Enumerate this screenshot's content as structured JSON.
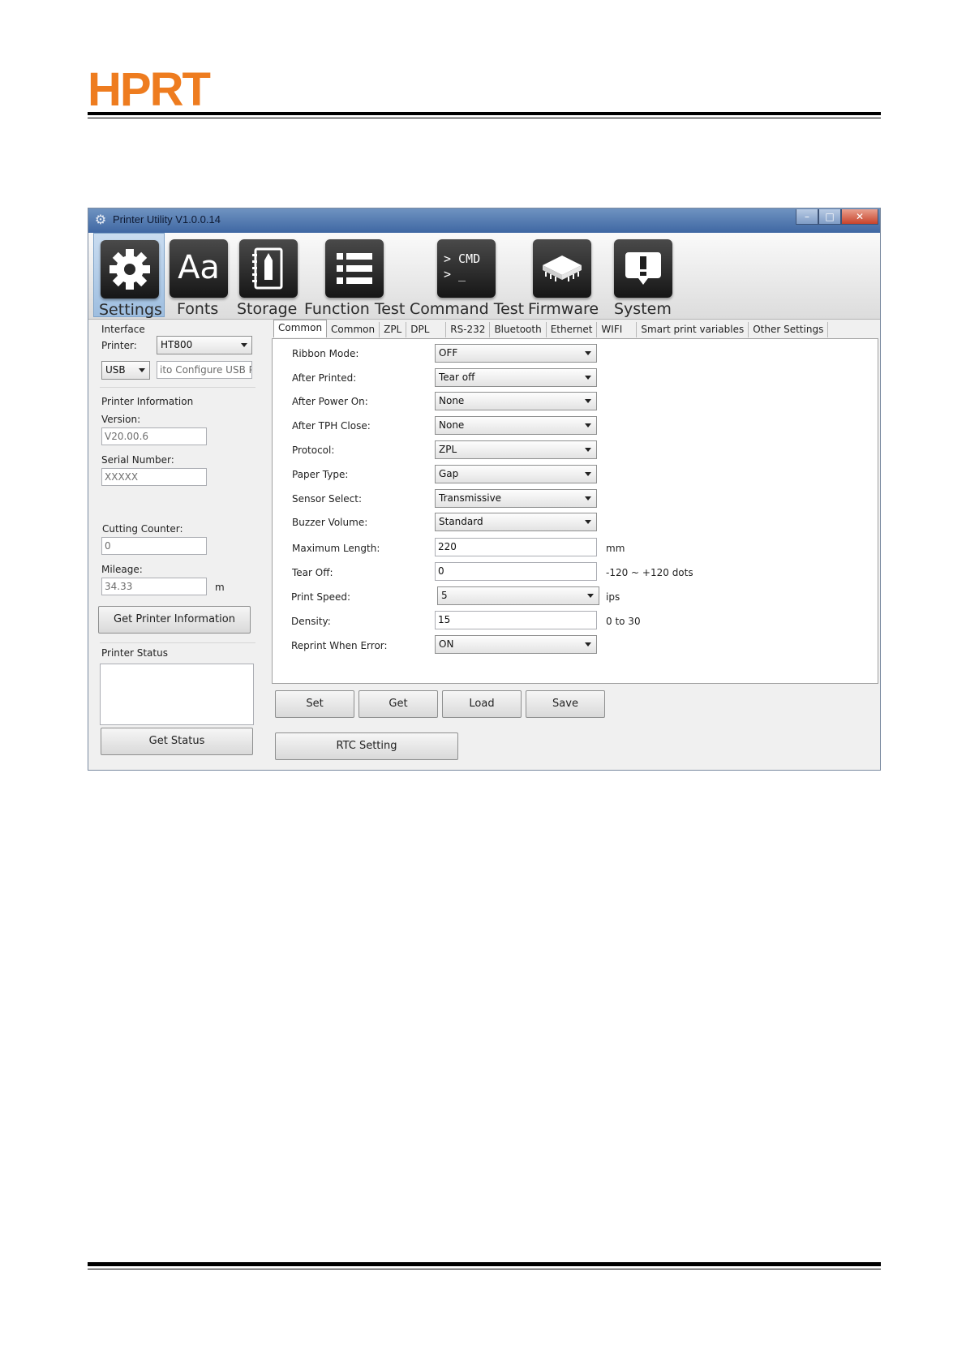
{
  "doc": {
    "brand": "HPRT"
  },
  "window": {
    "title": "Printer Utility  V1.0.0.14",
    "buttons": {
      "minimize": "–",
      "maximize": "□",
      "close": "✕"
    }
  },
  "toolbar": {
    "items": [
      {
        "label": "Settings",
        "icon": "gear-icon"
      },
      {
        "label": "Fonts",
        "icon": "font-icon",
        "glyph": "Aa"
      },
      {
        "label": "Storage",
        "icon": "storage-icon"
      },
      {
        "label": "Function Test",
        "icon": "list-icon"
      },
      {
        "label": "Command Test",
        "icon": "terminal-icon",
        "glyph1": "> CMD",
        "glyph2": "> _"
      },
      {
        "label": "Firmware",
        "icon": "chip-icon"
      },
      {
        "label": "System",
        "icon": "alert-icon"
      }
    ]
  },
  "left": {
    "interface_label": "Interface",
    "printer_label": "Printer:",
    "printer_value": "HT800",
    "port_value": "USB",
    "port_config_placeholder": "ito Configure USB Pc",
    "info_label": "Printer Information",
    "version_label": "Version:",
    "version_value": "V20.00.6",
    "serial_label": "Serial Number:",
    "serial_value": "XXXXX",
    "cutting_label": "Cutting Counter:",
    "cutting_value": "0",
    "mileage_label": "Mileage:",
    "mileage_value": "34.33",
    "mileage_unit": "m",
    "get_info_button": "Get Printer Information",
    "status_label": "Printer Status",
    "get_status_button": "Get Status"
  },
  "tabs": [
    "Common",
    "Common",
    "ZPL",
    "DPL",
    "RS-232",
    "Bluetooth",
    "Ethernet",
    "WIFI",
    "Smart print variables",
    "Other Settings"
  ],
  "settings": {
    "ribbon_mode": {
      "label": "Ribbon Mode:",
      "value": "OFF"
    },
    "after_printed": {
      "label": "After Printed:",
      "value": "Tear off"
    },
    "after_power_on": {
      "label": "After Power On:",
      "value": "None"
    },
    "after_tph_close": {
      "label": "After TPH Close:",
      "value": "None"
    },
    "protocol": {
      "label": "Protocol:",
      "value": "ZPL"
    },
    "paper_type": {
      "label": "Paper Type:",
      "value": "Gap"
    },
    "sensor_select": {
      "label": "Sensor Select:",
      "value": "Transmissive"
    },
    "buzzer_volume": {
      "label": "Buzzer Volume:",
      "value": "Standard"
    },
    "max_length": {
      "label": "Maximum Length:",
      "value": "220",
      "unit": "mm"
    },
    "tear_off": {
      "label": "Tear Off:",
      "value": "0",
      "unit": "-120 ~ +120 dots"
    },
    "print_speed": {
      "label": "Print Speed:",
      "value": "5",
      "unit": "ips"
    },
    "density": {
      "label": "Density:",
      "value": "15",
      "unit": "0 to 30"
    },
    "reprint_when_error": {
      "label": "Reprint When Error:",
      "value": "ON"
    }
  },
  "actions": {
    "set": "Set",
    "get": "Get",
    "load": "Load",
    "save": "Save",
    "rtc": "RTC Setting"
  },
  "colors": {
    "brand": "#ee7c1f",
    "titlebar": "#3f67a3",
    "active_tool": "#9ebee0"
  }
}
